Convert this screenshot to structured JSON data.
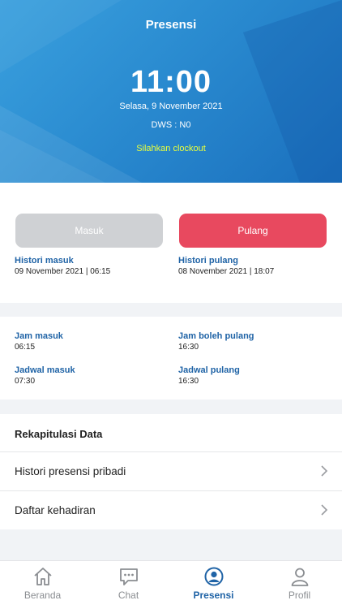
{
  "header": {
    "title": "Presensi",
    "time": "11:00",
    "date": "Selasa, 9 November 2021",
    "dws": "DWS : N0",
    "hint": "Silahkan clockout"
  },
  "actions": {
    "masuk_label": "Masuk",
    "pulang_label": "Pulang"
  },
  "history": {
    "masuk_label": "Histori masuk",
    "masuk_value": "09 November 2021 | 06:15",
    "pulang_label": "Histori pulang",
    "pulang_value": "08 November 2021 | 18:07"
  },
  "schedule": {
    "jam_masuk_label": "Jam masuk",
    "jam_masuk_value": "06:15",
    "jam_boleh_pulang_label": "Jam boleh pulang",
    "jam_boleh_pulang_value": "16:30",
    "jadwal_masuk_label": "Jadwal masuk",
    "jadwal_masuk_value": "07:30",
    "jadwal_pulang_label": "Jadwal pulang",
    "jadwal_pulang_value": "16:30"
  },
  "recap": {
    "title": "Rekapitulasi Data",
    "items": [
      {
        "label": "Histori presensi pribadi",
        "icon": "chevron-right-icon"
      },
      {
        "label": "Daftar kehadiran",
        "icon": "chevron-right-icon"
      }
    ]
  },
  "tabbar": {
    "items": [
      {
        "label": "Beranda",
        "icon": "home-icon"
      },
      {
        "label": "Chat",
        "icon": "chat-icon"
      },
      {
        "label": "Presensi",
        "icon": "presence-icon"
      },
      {
        "label": "Profil",
        "icon": "profile-icon"
      }
    ],
    "active": "Presensi"
  },
  "colors": {
    "hero_blue": "#2a8bd0",
    "pulang_red": "#e8495f",
    "masuk_grey": "#cfd1d4",
    "label_blue": "#1f63a6",
    "hint_yellow": "#e9ff3c"
  }
}
